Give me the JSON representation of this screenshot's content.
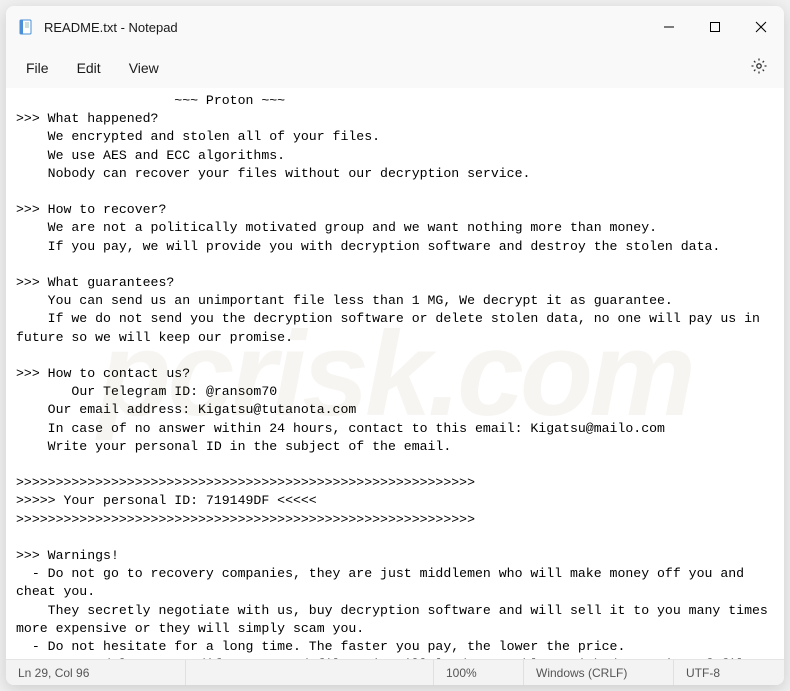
{
  "window": {
    "title": "README.txt - Notepad"
  },
  "menubar": {
    "file": "File",
    "edit": "Edit",
    "view": "View"
  },
  "document": {
    "text": "                    ~~~ Proton ~~~\n>>> What happened?\n    We encrypted and stolen all of your files.\n    We use AES and ECC algorithms.\n    Nobody can recover your files without our decryption service.\n\n>>> How to recover?\n    We are not a politically motivated group and we want nothing more than money.\n    If you pay, we will provide you with decryption software and destroy the stolen data.\n\n>>> What guarantees?\n    You can send us an unimportant file less than 1 MG, We decrypt it as guarantee.\n    If we do not send you the decryption software or delete stolen data, no one will pay us in future so we will keep our promise.\n\n>>> How to contact us?\n       Our Telegram ID: @ransom70\n    Our email address: Kigatsu@tutanota.com\n    In case of no answer within 24 hours, contact to this email: Kigatsu@mailo.com\n    Write your personal ID in the subject of the email.\n\n>>>>>>>>>>>>>>>>>>>>>>>>>>>>>>>>>>>>>>>>>>>>>>>>>>>>>>>>>>\n>>>>> Your personal ID: 719149DF <<<<<\n>>>>>>>>>>>>>>>>>>>>>>>>>>>>>>>>>>>>>>>>>>>>>>>>>>>>>>>>>>\n\n>>> Warnings!\n  - Do not go to recovery companies, they are just middlemen who will make money off you and cheat you.\n    They secretly negotiate with us, buy decryption software and will sell it to you many times more expensive or they will simply scam you.\n  - Do not hesitate for a long time. The faster you pay, the lower the price.\n  - Do not delete or modify encrypted files, it will lead to problems with decryption of files."
  },
  "statusbar": {
    "position": "Ln 29, Col 96",
    "zoom": "100%",
    "lineending": "Windows (CRLF)",
    "encoding": "UTF-8"
  }
}
